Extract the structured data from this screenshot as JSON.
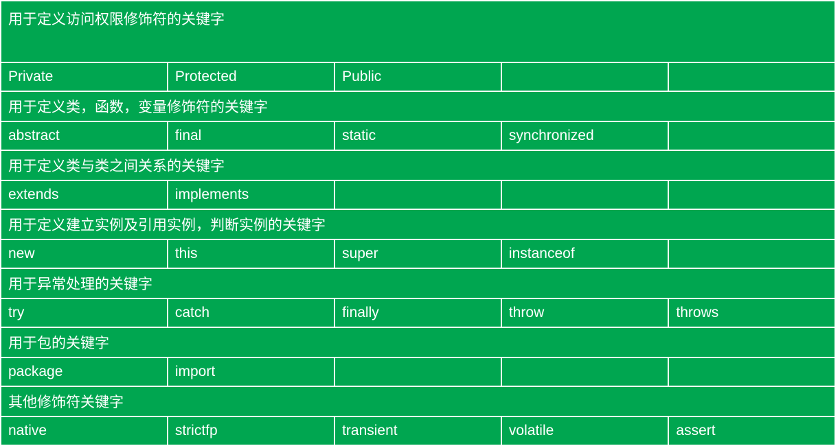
{
  "sections": [
    {
      "title": "用于定义访问权限修饰符的关键字",
      "tall": true,
      "cells": [
        "Private",
        "Protected",
        "Public",
        "",
        ""
      ]
    },
    {
      "title": "用于定义类，函数，变量修饰符的关键字",
      "tall": false,
      "cells": [
        "abstract",
        "final",
        "static",
        "synchronized",
        ""
      ]
    },
    {
      "title": "用于定义类与类之间关系的关键字",
      "tall": false,
      "cells": [
        "extends",
        "implements",
        "",
        "",
        ""
      ]
    },
    {
      "title": "用于定义建立实例及引用实例，判断实例的关键字",
      "tall": false,
      "cells": [
        "new",
        "this",
        "super",
        "instanceof",
        ""
      ]
    },
    {
      "title": "用于异常处理的关键字",
      "tall": false,
      "cells": [
        "try",
        "catch",
        "finally",
        "throw",
        "throws"
      ]
    },
    {
      "title": "用于包的关键字",
      "tall": false,
      "cells": [
        "package",
        "import",
        "",
        "",
        ""
      ]
    },
    {
      "title": "其他修饰符关键字",
      "tall": false,
      "cells": [
        "native",
        "strictfp",
        "transient",
        "volatile",
        "assert"
      ]
    }
  ]
}
